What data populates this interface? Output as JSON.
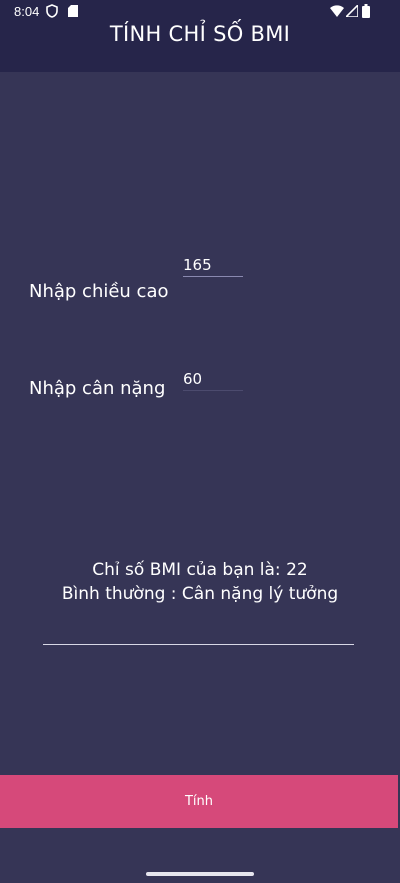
{
  "status_bar": {
    "time": "8:04",
    "icons": [
      "shield-icon",
      "sd-card-icon",
      "wifi-icon",
      "signal-icon",
      "battery-icon"
    ]
  },
  "app": {
    "title": "TÍNH CHỈ SỐ BMI"
  },
  "form": {
    "height_label": "Nhập chiều cao",
    "height_value": "165",
    "weight_label": "Nhập cân nặng",
    "weight_value": "60"
  },
  "result": {
    "bmi_text": "Chỉ số BMI của bạn là: 22",
    "status_text": "Bình thường : Cân nặng lý tưởng"
  },
  "actions": {
    "calculate_label": "Tính"
  },
  "colors": {
    "background": "#363556",
    "header": "#26254a",
    "button": "#d6497a",
    "text": "#ffffff"
  }
}
